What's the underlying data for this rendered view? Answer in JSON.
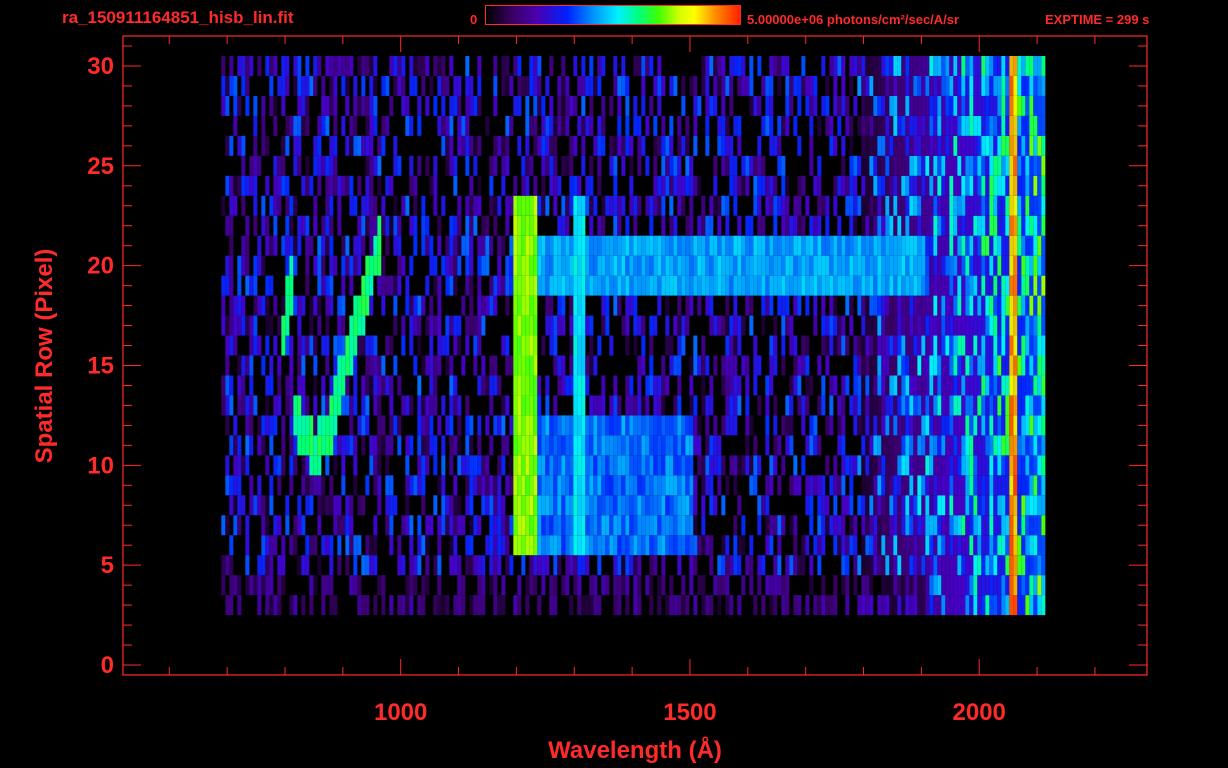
{
  "header": {
    "filename": "ra_150911164851_hisb_lin.fit",
    "cbar_min": "0",
    "cbar_max_label": "5.00000e+06 photons/cm²/sec/A/sr",
    "exptime": "EXPTIME = 299 s"
  },
  "colors": {
    "axis": "#ff2a2a",
    "background": "#000000"
  },
  "chart_data": {
    "type": "heatmap",
    "title": "",
    "xlabel": "Wavelength (Å)",
    "ylabel": "Spatial Row (Pixel)",
    "xlim": [
      520,
      2290
    ],
    "ylim": [
      -0.5,
      31.5
    ],
    "x_ticks": [
      1000,
      1500,
      2000
    ],
    "y_ticks": [
      0,
      5,
      10,
      15,
      20,
      25,
      30
    ],
    "data_x_range": [
      690,
      2110
    ],
    "data_rows": [
      3,
      30
    ],
    "colorbar": {
      "min": 0,
      "max": 5000000,
      "units": "photons/cm²/sec/A/sr",
      "colormap": "rainbow"
    },
    "features": [
      {
        "name": "Lyman-alpha band",
        "x": [
          1190,
          1230
        ],
        "rows": [
          5,
          23
        ]
      },
      {
        "name": "secondary band",
        "x": [
          1295,
          1315
        ],
        "rows": [
          6,
          23
        ]
      },
      {
        "name": "curved arc",
        "path": [
          [
            810,
            19.5
          ],
          [
            790,
            16
          ],
          [
            800,
            13.5
          ],
          [
            830,
            11.5
          ],
          [
            850,
            10.5
          ],
          [
            875,
            12
          ],
          [
            905,
            15.5
          ],
          [
            935,
            18.5
          ],
          [
            960,
            21
          ]
        ]
      },
      {
        "name": "red edge",
        "x": [
          2050,
          2065
        ],
        "rows": [
          1,
          30
        ]
      }
    ]
  }
}
